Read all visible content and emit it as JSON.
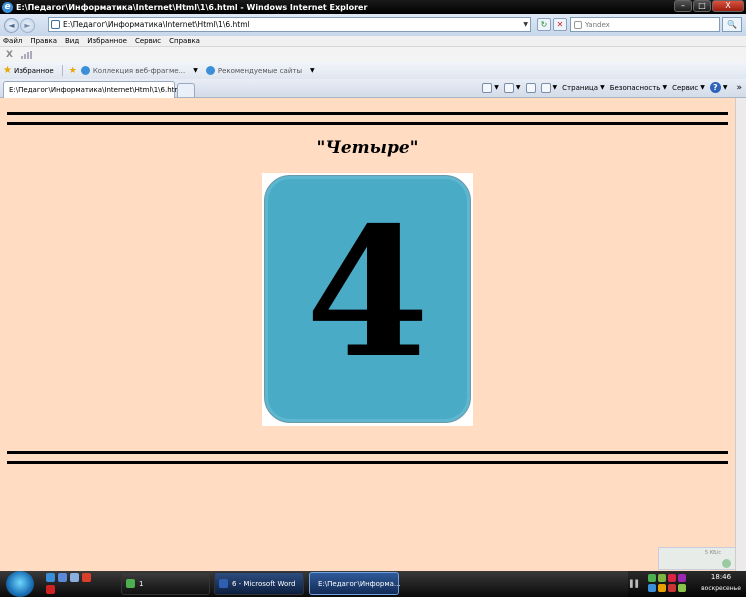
{
  "window": {
    "title": "E:\\Педагог\\Информатика\\Internet\\Html\\1\\6.html - Windows Internet Explorer",
    "controls": {
      "minimize": "–",
      "maximize": "□",
      "close": "X"
    }
  },
  "nav": {
    "back": "◄",
    "forward": "►",
    "address": "E:\\Педагог\\Информатика\\Internet\\Html\\1\\6.html",
    "refresh": "↻",
    "stop": "✕",
    "search_placeholder": "Yandex",
    "search_go": "🔍"
  },
  "menu": {
    "items": [
      "Файл",
      "Правка",
      "Вид",
      "Избранное",
      "Сервис",
      "Справка"
    ]
  },
  "extra_toolbar": {
    "close": "X"
  },
  "favorites": {
    "label": "Избранное",
    "items": [
      "Коллекция веб-фрагме...",
      "Рекомендуемые сайты"
    ]
  },
  "tab": {
    "title": "E:\\Педагог\\Информатика\\Internet\\Html\\1\\6.html"
  },
  "commands": {
    "page": "Страница",
    "safety": "Безопасность",
    "tools": "Сервис",
    "help": "?"
  },
  "page": {
    "heading": "\"Четыре\"",
    "digit": "4",
    "card_color": "#4aabc7",
    "background": "#ffdcc2"
  },
  "popup_widget": {
    "text": "5 КБ/с"
  },
  "taskbar": {
    "tasks": [
      "1",
      "6 - Microsoft Word",
      "E:\\Педагог\\Информа..."
    ],
    "time": "18:46",
    "day": "воскресенье"
  }
}
